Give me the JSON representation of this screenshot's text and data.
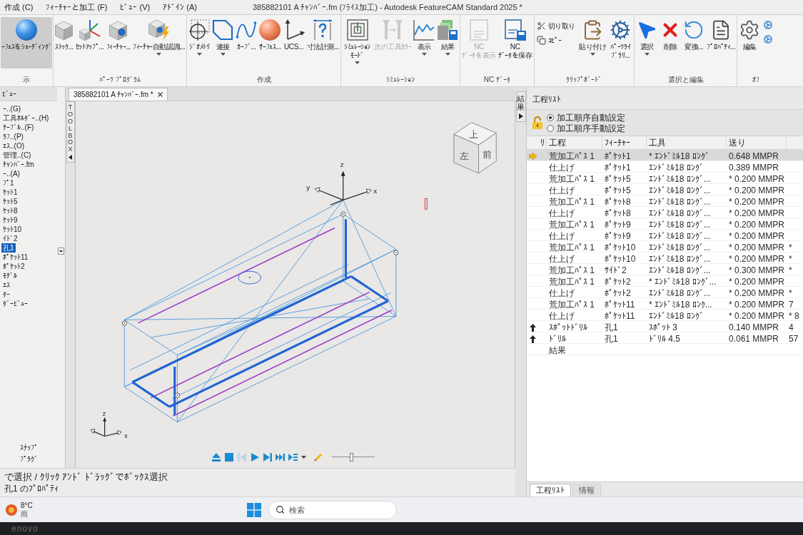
{
  "title_bar": {
    "menus": [
      "作成 (C)",
      "ﾌｨｰﾁｬｰと加工 (F)",
      "ﾋﾞｭｰ (V)",
      "ｱﾄﾞｲﾝ (A)"
    ],
    "title": "385882101 A ﾁｬﾝﾊﾞｰ.fm (ﾌﾗｲｽ加工) - Autodesk FeatureCAM Standard 2025 *"
  },
  "ribbon": {
    "groups": [
      {
        "label": "示",
        "buttons": [
          {
            "label": "ｰﾌｪｽをｼｪｰﾃﾞｨﾝｸﾞ",
            "on": true,
            "dropdown": false
          }
        ]
      },
      {
        "label": "ﾊﾟｰﾂ ﾌﾟﾛｸﾞﾗﾑ",
        "buttons": [
          {
            "label": "ｽﾄｯｸ...",
            "dropdown": false
          },
          {
            "label": "ｾｯﾄｱｯﾌﾟ...",
            "dropdown": false
          },
          {
            "label": "ﾌｨｰﾁｬｰ...",
            "dropdown": false
          },
          {
            "label": "ﾌｨｰﾁｬｰ自動認識...",
            "dropdown": true
          }
        ]
      },
      {
        "label": "作成",
        "buttons": [
          {
            "label": "ｼﾞｵﾒﾄﾘ",
            "dropdown": true
          },
          {
            "label": "連接",
            "dropdown": true
          },
          {
            "label": "ｶｰﾌﾞ...",
            "dropdown": false
          },
          {
            "label": "ｻｰﾌｪｽ...",
            "dropdown": false
          },
          {
            "label": "UCS...",
            "dropdown": false
          },
          {
            "label": "寸法計測...",
            "dropdown": false
          }
        ]
      },
      {
        "label": "ｼﾐｭﾚｰｼｮﾝ",
        "buttons": [
          {
            "label": "ｼﾐｭﾚｰｼｮﾝﾓｰﾄﾞ",
            "dropdown": true,
            "disabled": false
          },
          {
            "label": "次の工具ｶﾗｰ",
            "dropdown": false,
            "disabled": true
          },
          {
            "label": "表示",
            "dropdown": true,
            "disabled": false
          },
          {
            "label": "結果",
            "dropdown": true,
            "disabled": false
          }
        ]
      },
      {
        "label": "NC ﾃﾞｰﾀ",
        "buttons": [
          {
            "label": "NC\nﾃﾞｰﾀを表示",
            "dropdown": false,
            "disabled": true
          },
          {
            "label": "NC\nﾃﾞｰﾀを保存",
            "dropdown": false,
            "disabled": false
          }
        ]
      },
      {
        "label": "ｸﾘｯﾌﾟﾎﾞｰﾄﾞ",
        "buttons": [
          {
            "kind": "small",
            "label": "切り取り",
            "dropdown": false
          },
          {
            "kind": "small",
            "label": "ｺﾋﾟｰ",
            "dropdown": false
          },
          {
            "kind": "large",
            "label": "貼り付け",
            "dropdown": true
          },
          {
            "kind": "large",
            "label": "ﾊﾟｰﾂﾗｲﾌﾞﾗﾘ...",
            "dropdown": false
          }
        ]
      },
      {
        "label": "選択と編集",
        "buttons": [
          {
            "label": "選択",
            "dropdown": true
          },
          {
            "label": "削除",
            "dropdown": false
          },
          {
            "label": "変換...",
            "dropdown": false
          },
          {
            "label": "ﾌﾟﾛﾊﾟﾃｨ...",
            "dropdown": false
          }
        ]
      },
      {
        "label": "ｵﾌ",
        "buttons": [
          {
            "label": "編集",
            "dropdown": false
          }
        ]
      }
    ]
  },
  "left_panel": {
    "header": "ﾋﾞｭｰ",
    "items": [
      {
        "label": "ｰ..(G)",
        "selected": false
      },
      {
        "label": "工具ﾎﾙﾀﾞｰ..(H)",
        "selected": false
      },
      {
        "label": "ﾃｰﾌﾞﾙ..(F)",
        "selected": false
      },
      {
        "label": "ﾗﾌ..(P)",
        "selected": false
      },
      {
        "label": "ｴｽ..(O)",
        "selected": false
      },
      {
        "label": "管理..(C)",
        "selected": false
      },
      {
        "label": "ﾁｬﾝﾊﾞｰ.fm",
        "selected": false
      },
      {
        "label": "ｰ..(A)",
        "selected": false
      },
      {
        "label": "ﾌﾟ1",
        "selected": false
      },
      {
        "label": "ｹｯﾄ1",
        "selected": false
      },
      {
        "label": "ｹｯﾄ5",
        "selected": false
      },
      {
        "label": "ｹｯﾄ8",
        "selected": false
      },
      {
        "label": "ｹｯﾄ9",
        "selected": false
      },
      {
        "label": "ｹｯﾄ10",
        "selected": false
      },
      {
        "label": "ｲﾄﾞ2",
        "selected": false
      },
      {
        "label": "孔1",
        "selected": true
      },
      {
        "label": "ﾎﾟｹｯﾄ11",
        "selected": false
      },
      {
        "label": "ﾎﾟｹｯﾄ2",
        "selected": false
      },
      {
        "label": "ﾓﾃﾞﾙ",
        "selected": false
      },
      {
        "label": "ｴｽ",
        "selected": false
      },
      {
        "label": "ﾀｰ",
        "selected": false
      },
      {
        "label": "ﾀﾞｰﾋﾞｭｰ",
        "selected": false
      }
    ],
    "bottom_items": [
      "ｽﾅｯﾌﾟ",
      "ﾌﾟﾗｸﾞ"
    ]
  },
  "document_tab": {
    "label": "385882101 A ﾁｬﾝﾊﾞｰ.fm *"
  },
  "toolbox": {
    "label": "TOOLBOX"
  },
  "viewport": {
    "triad_labels": [
      "z",
      "y",
      "x"
    ],
    "view_cube": [
      "上",
      "左",
      "前"
    ],
    "corner_triad_labels": [
      "z",
      "x"
    ]
  },
  "simulation_toolbar": {
    "buttons": [
      {
        "disabled": false
      },
      {
        "disabled": false
      },
      {
        "disabled": true
      },
      {
        "disabled": false
      },
      {
        "disabled": false
      },
      {
        "disabled": false
      },
      {
        "disabled": false
      }
    ],
    "speed": {
      "level": 0.45
    }
  },
  "status_bar": {
    "hint": "で選択 / ｸﾘｯｸ ｱﾝﾄﾞ ﾄﾞﾗｯｸﾞでﾎﾞｯｸｽ選択",
    "properties": "孔1 のﾌﾟﾛﾊﾟﾃｨ"
  },
  "results_tab": {
    "label": "結果"
  },
  "process_list": {
    "title": "工程ﾘｽﾄ",
    "radios": [
      {
        "label": "加工順序自動設定",
        "selected": true
      },
      {
        "label": "加工順序手動設定",
        "selected": false
      }
    ],
    "columns": [
      "ﾘ",
      "工程",
      "ﾌｨｰﾁｬｰ",
      "工具",
      "送り"
    ],
    "rows": [
      {
        "kind": "current",
        "selected": true,
        "operation": "荒加工ﾊﾟｽ 1",
        "feature": "ﾎﾟｹｯﾄ1",
        "tool": "* ｴﾝﾄﾞﾐﾙ18 ﾛﾝｸﾞ",
        "feed": "0.648 MMPR"
      },
      {
        "kind": "plain",
        "selected": false,
        "operation": "仕上げ",
        "feature": "ﾎﾟｹｯﾄ1",
        "tool": "ｴﾝﾄﾞﾐﾙ18 ﾛﾝｸﾞ",
        "feed": "0.389 MMPR"
      },
      {
        "kind": "plain",
        "selected": false,
        "operation": "荒加工ﾊﾟｽ 1",
        "feature": "ﾎﾟｹｯﾄ5",
        "tool": "ｴﾝﾄﾞﾐﾙ18 ﾛﾝｸﾞ...",
        "feed": "* 0.200 MMPR"
      },
      {
        "kind": "plain",
        "selected": false,
        "operation": "仕上げ",
        "feature": "ﾎﾟｹｯﾄ5",
        "tool": "ｴﾝﾄﾞﾐﾙ18 ﾛﾝｸﾞ...",
        "feed": "* 0.200 MMPR"
      },
      {
        "kind": "plain",
        "selected": false,
        "operation": "荒加工ﾊﾟｽ 1",
        "feature": "ﾎﾟｹｯﾄ8",
        "tool": "ｴﾝﾄﾞﾐﾙ18 ﾛﾝｸﾞ...",
        "feed": "* 0.200 MMPR"
      },
      {
        "kind": "plain",
        "selected": false,
        "operation": "仕上げ",
        "feature": "ﾎﾟｹｯﾄ8",
        "tool": "ｴﾝﾄﾞﾐﾙ18 ﾛﾝｸﾞ...",
        "feed": "* 0.200 MMPR"
      },
      {
        "kind": "plain",
        "selected": false,
        "operation": "荒加工ﾊﾟｽ 1",
        "feature": "ﾎﾟｹｯﾄ9",
        "tool": "ｴﾝﾄﾞﾐﾙ18 ﾛﾝｸﾞ...",
        "feed": "* 0.200 MMPR"
      },
      {
        "kind": "plain",
        "selected": false,
        "operation": "仕上げ",
        "feature": "ﾎﾟｹｯﾄ9",
        "tool": "ｴﾝﾄﾞﾐﾙ18 ﾛﾝｸﾞ...",
        "feed": "* 0.200 MMPR"
      },
      {
        "kind": "plain",
        "selected": false,
        "operation": "荒加工ﾊﾟｽ 1",
        "feature": "ﾎﾟｹｯﾄ10",
        "tool": "ｴﾝﾄﾞﾐﾙ18 ﾛﾝｸﾞ...",
        "feed": "* 0.200 MMPR",
        "column_6": "*"
      },
      {
        "kind": "plain",
        "selected": false,
        "operation": "仕上げ",
        "feature": "ﾎﾟｹｯﾄ10",
        "tool": "ｴﾝﾄﾞﾐﾙ18 ﾛﾝｸﾞ...",
        "feed": "* 0.200 MMPR",
        "column_6": "*"
      },
      {
        "kind": "plain",
        "selected": false,
        "operation": "荒加工ﾊﾟｽ 1",
        "feature": "ｻｲﾄﾞ2",
        "tool": "ｴﾝﾄﾞﾐﾙ18 ﾛﾝｸﾞ...",
        "feed": "* 0.300 MMPR",
        "column_6": "*"
      },
      {
        "kind": "plain",
        "selected": false,
        "operation": "荒加工ﾊﾟｽ 1",
        "feature": "ﾎﾟｹｯﾄ2",
        "tool": "* ｴﾝﾄﾞﾐﾙ18 ﾛﾝｸﾞ...",
        "feed": "* 0.200 MMPR"
      },
      {
        "kind": "plain",
        "selected": false,
        "operation": "仕上げ",
        "feature": "ﾎﾟｹｯﾄ2",
        "tool": "ｴﾝﾄﾞﾐﾙ18 ﾛﾝｸﾞ...",
        "feed": "* 0.200 MMPR",
        "column_6": "*"
      },
      {
        "kind": "plain",
        "selected": false,
        "operation": "荒加工ﾊﾟｽ 1",
        "feature": "ﾎﾟｹｯﾄ11",
        "tool": "* ｴﾝﾄﾞﾐﾙ18 ﾛﾝｸ...",
        "feed": "* 0.200 MMPR",
        "column_6": "7"
      },
      {
        "kind": "plain",
        "selected": false,
        "operation": "仕上げ",
        "feature": "ﾎﾟｹｯﾄ11",
        "tool": "ｴﾝﾄﾞﾐﾙ18 ﾛﾝｸﾞ",
        "feed": "* 0.200 MMPR",
        "column_6": "* 8"
      },
      {
        "kind": "moved",
        "selected": false,
        "operation": "ｽﾎﾟｯﾄﾄﾞﾘﾙ",
        "feature": "孔1",
        "tool": "ｽﾎﾟｯﾄ 3",
        "feed": "0.140 MMPR",
        "column_6": "4"
      },
      {
        "kind": "moved",
        "selected": false,
        "operation": "ﾄﾞﾘﾙ",
        "feature": "孔1",
        "tool": "ﾄﾞﾘﾙ 4.5",
        "feed": "0.061 MMPR",
        "column_6": "57"
      },
      {
        "kind": "plain",
        "selected": false,
        "operation": "結果"
      }
    ],
    "tabs": [
      {
        "label": "工程ﾘｽﾄ",
        "selected": true
      },
      {
        "label": "情報",
        "selected": false
      }
    ]
  },
  "taskbar": {
    "weather": {
      "temperature": "8°C",
      "condition": "雨"
    },
    "search": {
      "placeholder": "検索"
    }
  },
  "monitor": {
    "brand": "enovo"
  }
}
